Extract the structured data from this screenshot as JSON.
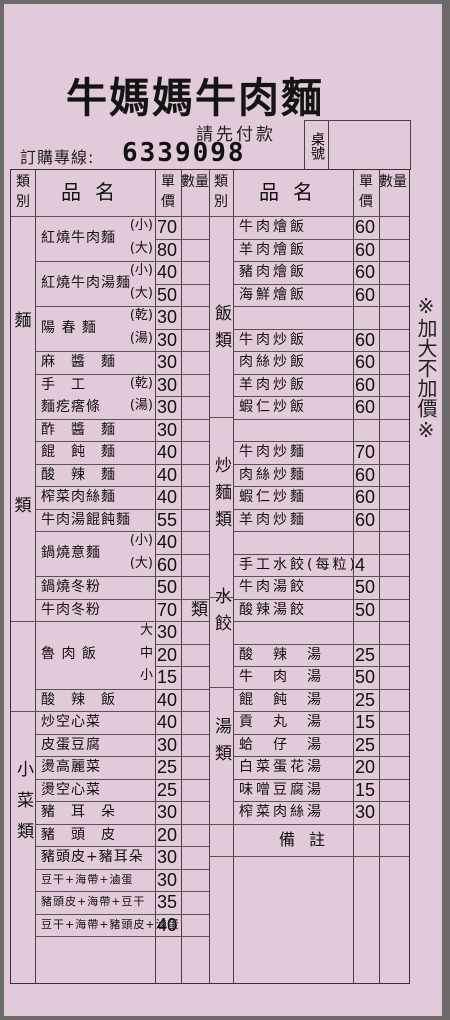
{
  "header": {
    "title": "牛媽媽牛肉麵",
    "prepay": "請先付款",
    "hotline_label": "訂購專線:",
    "hotline_number": "6339098",
    "table_label": "桌號"
  },
  "columns": {
    "category": "類別",
    "item": "品名",
    "unit_price": "單價",
    "quantity": "數量"
  },
  "left_categories": [
    {
      "label": "麵",
      "sub": "類"
    },
    {
      "label": "小菜類"
    }
  ],
  "left_items": [
    {
      "name": "紅燒牛肉麵",
      "sizes": [
        {
          "size": "(小)",
          "price": "70"
        },
        {
          "size": "(大)",
          "price": "80"
        }
      ]
    },
    {
      "name": "紅燒牛肉湯麵",
      "sizes": [
        {
          "size": "(小)",
          "price": "40"
        },
        {
          "size": "(大)",
          "price": "50"
        }
      ]
    },
    {
      "name": "陽 春 麵",
      "sizes": [
        {
          "size": "(乾)",
          "price": "30"
        },
        {
          "size": "(湯)",
          "price": "30"
        }
      ]
    },
    {
      "name": "麻　醬　麵",
      "price": "30"
    },
    {
      "name": "手　工",
      "name2": "麵疙瘩條",
      "sizes": [
        {
          "size": "(乾)",
          "price": "30"
        },
        {
          "size": "(湯)",
          "price": "30"
        }
      ]
    },
    {
      "name": "酢　醬　麵",
      "price": "30"
    },
    {
      "name": "餛　飩　麵",
      "price": "40"
    },
    {
      "name": "酸　辣　麵",
      "price": "40"
    },
    {
      "name": "榨菜肉絲麵",
      "price": "40"
    },
    {
      "name": "牛肉湯餛飩麵",
      "price": "55"
    },
    {
      "name": "鍋燒意麵",
      "sizes": [
        {
          "size": "(小)",
          "price": "40"
        },
        {
          "size": "(大)",
          "price": "60"
        }
      ]
    },
    {
      "name": "鍋燒冬粉",
      "price": "50"
    },
    {
      "name": "牛肉冬粉",
      "price": "70"
    },
    {
      "name": "魯 肉 飯",
      "sizes": [
        {
          "size": "大",
          "price": "30"
        },
        {
          "size": "中",
          "price": "20"
        },
        {
          "size": "小",
          "price": "15"
        }
      ]
    },
    {
      "name": "酸　辣　飯",
      "price": "40"
    },
    {
      "name": "炒空心菜",
      "price": "40"
    },
    {
      "name": "皮蛋豆腐",
      "price": "30"
    },
    {
      "name": "燙高麗菜",
      "price": "25"
    },
    {
      "name": "燙空心菜",
      "price": "25"
    },
    {
      "name": "豬　耳　朵",
      "price": "30"
    },
    {
      "name": "豬　頭　皮",
      "price": "20"
    },
    {
      "name": "豬頭皮+豬耳朵",
      "price": "30"
    },
    {
      "name": "豆干+海帶+滷蛋",
      "price": "30"
    },
    {
      "name": "豬頭皮+海帶+豆干",
      "price": "35"
    },
    {
      "name": "豆干+海帶+豬頭皮+滷蛋",
      "price": "40"
    }
  ],
  "right_categories": [
    "飯類",
    "炒麵類",
    "水餃類",
    "湯類"
  ],
  "right_items": [
    {
      "name": "牛肉燴飯",
      "price": "60"
    },
    {
      "name": "羊肉燴飯",
      "price": "60"
    },
    {
      "name": "豬肉燴飯",
      "price": "60"
    },
    {
      "name": "海鮮燴飯",
      "price": "60"
    },
    {
      "name": "牛肉炒飯",
      "price": "60"
    },
    {
      "name": "肉絲炒飯",
      "price": "60"
    },
    {
      "name": "羊肉炒飯",
      "price": "60"
    },
    {
      "name": "蝦仁炒飯",
      "price": "60"
    },
    {
      "name": "牛肉炒麵",
      "price": "70"
    },
    {
      "name": "肉絲炒麵",
      "price": "60"
    },
    {
      "name": "蝦仁炒麵",
      "price": "60"
    },
    {
      "name": "羊肉炒麵",
      "price": "60"
    },
    {
      "name": "手工水餃(每粒)",
      "price": "4"
    },
    {
      "name": "牛肉湯餃",
      "price": "50"
    },
    {
      "name": "酸辣湯餃",
      "price": "50"
    },
    {
      "name": "酸　辣　湯",
      "price": "25"
    },
    {
      "name": "牛　肉　湯",
      "price": "50"
    },
    {
      "name": "餛　飩　湯",
      "price": "25"
    },
    {
      "name": "貢　丸　湯",
      "price": "15"
    },
    {
      "name": "蛤　仔　湯",
      "price": "25"
    },
    {
      "name": "白菜蛋花湯",
      "price": "20"
    },
    {
      "name": "味噌豆腐湯",
      "price": "15"
    },
    {
      "name": "榨菜肉絲湯",
      "price": "30"
    }
  ],
  "remarks_label": "備註",
  "side_note": "※加大不加價※"
}
